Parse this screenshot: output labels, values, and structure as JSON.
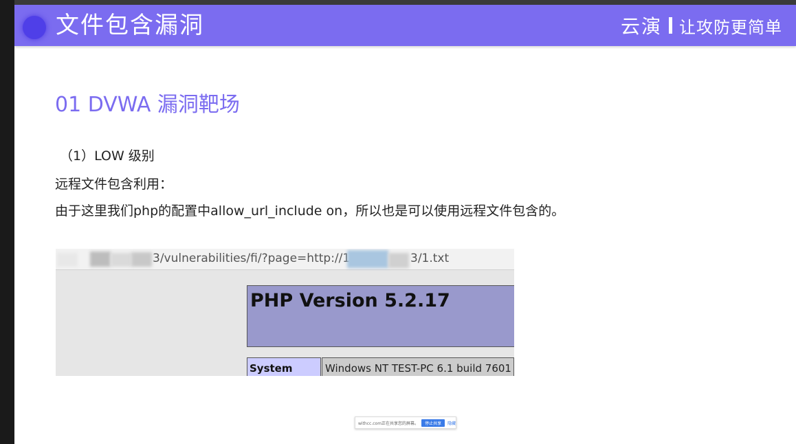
{
  "header": {
    "title": "文件包含漏洞",
    "brand_name": "云演",
    "brand_slogan": "让攻防更简单",
    "color": "#7b6cf0"
  },
  "content": {
    "section_title": "01 DVWA 漏洞靶场",
    "level": "（1）LOW 级别",
    "subheading": "远程文件包含利用：",
    "description": "由于这里我们php的配置中allow_url_include on，所以也是可以使用远程文件包含的。"
  },
  "screenshot": {
    "url_part1": "3/vulnerabilities/fi/?page=http://19",
    "url_part2": "3/1.txt",
    "php_version": "PHP Version 5.2.17",
    "system_label": "System",
    "system_value": "Windows NT TEST-PC 6.1 build 7601"
  },
  "share_bar": {
    "text": "withcc.com正在共享您的屏幕。",
    "stop_label": "停止共享",
    "hide_label": "隐藏"
  }
}
